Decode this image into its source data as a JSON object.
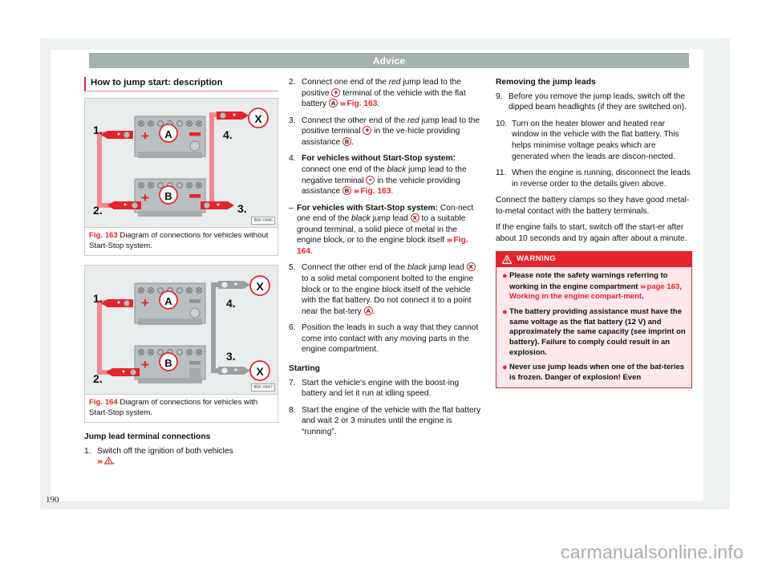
{
  "chapter": "Advice",
  "page_number": "190",
  "watermark": "carmanualsonline.info",
  "section_title": "How to jump start: description",
  "figures": [
    {
      "label": "Fig. 163",
      "caption": "Diagram of connections for vehicles without Start-Stop system.",
      "code": "B5F-0446",
      "markers": [
        "1.",
        "2.",
        "3.",
        "4."
      ],
      "battery_top": "A",
      "battery_bottom": "B",
      "x_markers": [
        "X"
      ],
      "lead_color": "red"
    },
    {
      "label": "Fig. 164",
      "caption": "Diagram of connections for vehicles with Start-Stop system.",
      "code": "B5F-0447",
      "markers": [
        "1.",
        "2.",
        "3.",
        "4."
      ],
      "battery_top": "A",
      "battery_bottom": "B",
      "x_markers": [
        "X",
        "X"
      ],
      "lead_color": "grey"
    }
  ],
  "col1": {
    "heading": "Jump lead terminal connections",
    "item1_num": "1.",
    "item1_a": "Switch off the ignition of both vehicles",
    "item1_chev": "›››",
    "item1_end": "."
  },
  "col2": {
    "item2_num": "2.",
    "item2_a": "Connect one end of the ",
    "item2_red": "red",
    "item2_b": " jump lead to the positive ",
    "item2_plus": "+",
    "item2_c": " terminal of the vehicle with the flat battery ",
    "item2_mark": "A",
    "item2_chev": "›››",
    "item2_ref": "Fig. 163",
    "item2_end": ".",
    "item3_num": "3.",
    "item3_a": "Connect the other end of the ",
    "item3_red": "red",
    "item3_b": " jump lead to the positive terminal ",
    "item3_plus": "+",
    "item3_c": " in the ve-hicle providing assistance ",
    "item3_mark": "B",
    "item3_end": ".",
    "item4_num": "4.",
    "item4_bold": "For vehicles without Start-Stop system:",
    "item4_a": " connect one end of the ",
    "item4_black": "black",
    "item4_b": " jump lead to the negative terminal ",
    "item4_minus": "−",
    "item4_c": " in the vehicle providing assistance ",
    "item4_mark": "B",
    "item4_chev": "›››",
    "item4_ref": "Fig. 163",
    "item4_end": ".",
    "item4b_dash": "–",
    "item4b_bold": "For vehicles with Start-Stop system:",
    "item4b_a": " Con-nect one end of the ",
    "item4b_black": "black",
    "item4b_b": " jump lead ",
    "item4b_mark": "X",
    "item4b_c": " to a suitable ground terminal, a solid piece of metal in the engine block, or to the engine block itself ",
    "item4b_chev": "›››",
    "item4b_ref": "Fig. 164",
    "item4b_end": ".",
    "item5_num": "5.",
    "item5_a": "Connect the other end of the ",
    "item5_black": "black",
    "item5_b": " jump lead ",
    "item5_mark": "X",
    "item5_c": " to a solid metal component bolted to the engine block or to the engine block itself of the vehicle with the flat battery. Do not connect it to a point near the bat-tery ",
    "item5_mark2": "A",
    "item5_end": ".",
    "item6_num": "6.",
    "item6_text": "Position the leads in such a way that they cannot come into contact with any moving parts in the engine compartment.",
    "starting_heading": "Starting",
    "item7_num": "7.",
    "item7_text": "Start the vehicle's engine with the boost-ing battery and let it run at idling speed.",
    "item8_num": "8.",
    "item8_text": "Start the engine of the vehicle with the flat battery and wait 2 or 3 minutes until the engine is “running”."
  },
  "col3": {
    "heading": "Removing the jump leads",
    "item9_num": "9.",
    "item9_text": "Before you remove the jump leads, switch off the dipped beam headlights (if they are switched on).",
    "item10_num": "10.",
    "item10_text": "Turn on the heater blower and heated rear window in the vehicle with the flat battery. This helps minimise voltage peaks which are generated when the leads are discon-nected.",
    "item11_num": "11.",
    "item11_text": "When the engine is running, disconnect the leads in reverse order to the details given above.",
    "para1": "Connect the battery clamps so they have good metal-to-metal contact with the battery terminals.",
    "para2": "If the engine fails to start, switch off the start-er after about 10 seconds and try again after about a minute.",
    "warning": {
      "title": "WARNING",
      "bullets": [
        {
          "text_a": "Please note the safety warnings referring to working in the engine compartment ",
          "chev": "›››",
          "ref": " page 163, Working in the engine compart-ment",
          "text_b": "."
        },
        {
          "text_a": "The battery providing assistance must have the same voltage as the flat battery (12 V) and approximately the same capacity (see imprint on battery). Failure to comply could result in an explosion.",
          "chev": "",
          "ref": "",
          "text_b": ""
        },
        {
          "text_a": "Never use jump leads when one of the bat-teries is frozen. Danger of explosion! Even",
          "chev": "",
          "ref": "",
          "text_b": ""
        }
      ]
    }
  },
  "colors": {
    "accent_red": "#e3242b",
    "chapter_bar": "#a6b2b0",
    "warning_bg": "#fde8ec",
    "page_bg": "#eef1f2"
  }
}
